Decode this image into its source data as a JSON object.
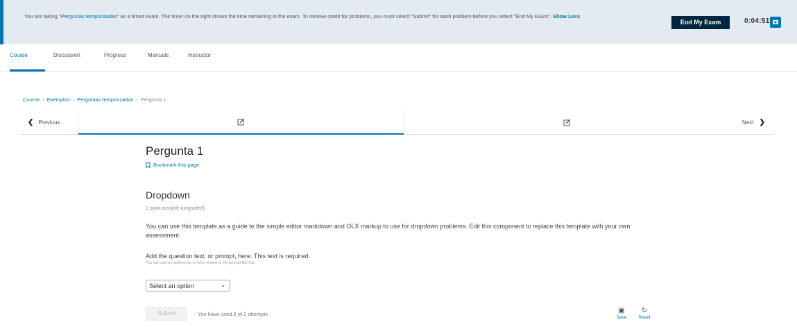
{
  "banner": {
    "message_prefix": "You are taking \"",
    "exam_name": "Perguntas temporizadas",
    "message_mid": "\" as a timed exam. The timer on the right shows the time remaining in the exam. To receive credit for problems, you must select \"Submit\" for each problem before you select \"End My Exam\".",
    "show_less": "Show Less",
    "end_exam_label": "End My Exam",
    "timer": "0:04:51"
  },
  "course_nav": {
    "tabs": [
      "Course",
      "Discussion",
      "Progress",
      "Manuals",
      "Instructor"
    ],
    "active": "Course"
  },
  "breadcrumb": {
    "items": [
      "Course",
      "Exemplos",
      "Perguntas temporizadas"
    ],
    "current": "Pergunta 1",
    "separator": "›"
  },
  "sequence": {
    "previous_label": "Previous",
    "next_label": "Next"
  },
  "unit": {
    "title": "Pergunta 1",
    "bookmark_label": "Bookmark this page"
  },
  "problem": {
    "title": "Dropdown",
    "points": "1 point possible (ungraded)",
    "description": "You can use this template as a guide to the simple editor markdown and OLX markup to use for dropdown problems. Edit this component to replace this template with your own assessment.",
    "question": "Add the question text, or prompt, here. This text is required.",
    "hint": "You can add an optional tip or note related to the prompt like this.",
    "select_value": "Select an option",
    "submit_label": "Submit",
    "attempts": "You have used 0 of 2 attempts",
    "save_label": "Save",
    "reset_label": "Reset"
  },
  "colors": {
    "accent": "#0075b4",
    "banner_bg": "#e3eaf0",
    "end_exam_bg": "#00263f"
  }
}
